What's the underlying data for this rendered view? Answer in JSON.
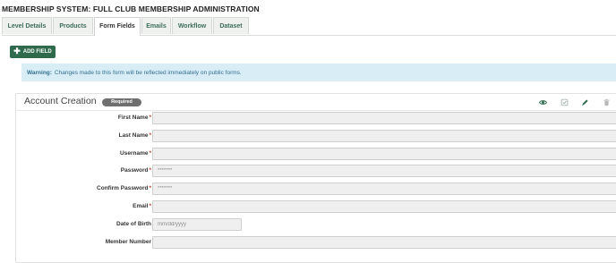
{
  "page": {
    "title": "MEMBERSHIP SYSTEM: FULL CLUB MEMBERSHIP ADMINISTRATION"
  },
  "tabs": [
    {
      "label": "Level Details",
      "active": false
    },
    {
      "label": "Products",
      "active": false
    },
    {
      "label": "Form Fields",
      "active": true
    },
    {
      "label": "Emails",
      "active": false
    },
    {
      "label": "Workflow",
      "active": false
    },
    {
      "label": "Dataset",
      "active": false
    }
  ],
  "toolbar": {
    "add_field_label": "ADD FIELD",
    "add_icon": "plus-icon"
  },
  "warning": {
    "title": "Warning:",
    "message": "Changes made to this form will be reflected immediately on public forms."
  },
  "panel": {
    "title": "Account Creation",
    "badge": "Required",
    "actions": [
      "eye-icon",
      "check-square-icon",
      "pencil-icon",
      "trash-icon"
    ]
  },
  "fields": [
    {
      "label": "First Name",
      "required": true,
      "value": "",
      "placeholder": ""
    },
    {
      "label": "Last Name",
      "required": true,
      "value": "",
      "placeholder": ""
    },
    {
      "label": "Username",
      "required": true,
      "value": "",
      "placeholder": ""
    },
    {
      "label": "Password",
      "required": true,
      "value": "*******",
      "placeholder": ""
    },
    {
      "label": "Confirm Password",
      "required": true,
      "value": "*******",
      "placeholder": ""
    },
    {
      "label": "Email",
      "required": true,
      "value": "",
      "placeholder": ""
    },
    {
      "label": "Date of Birth",
      "required": false,
      "value": "",
      "placeholder": "mm/dd/yyyy"
    },
    {
      "label": "Member Number",
      "required": false,
      "value": "",
      "placeholder": ""
    }
  ],
  "colors": {
    "brand": "#2f6a4d",
    "warning_bg": "#d9edf7",
    "required": "#c0392b"
  }
}
